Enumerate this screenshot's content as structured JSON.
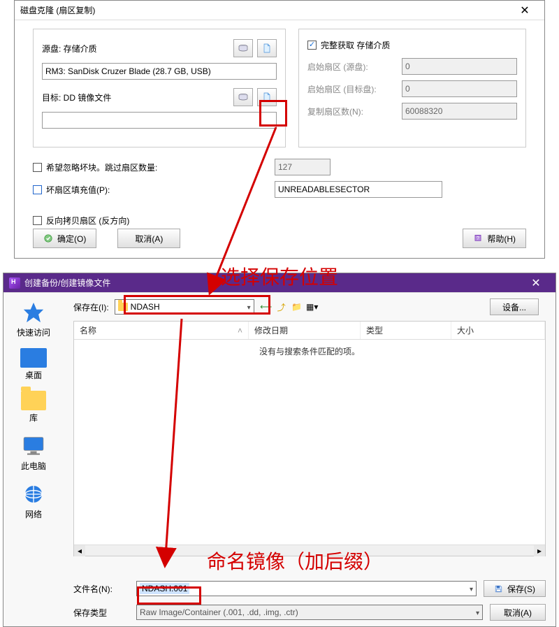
{
  "clone_dialog": {
    "title": "磁盘克隆 (扇区复制)",
    "source_label": "源盘: 存储介质",
    "source_value": "RM3: SanDisk Cruzer Blade (28.7 GB, USB)",
    "target_label": "目标: DD 镜像文件",
    "target_value": "",
    "full_extract_label": "完整获取 存储介质",
    "start_sector_src_label": "启始扇区 (源盘):",
    "start_sector_src_value": "0",
    "start_sector_dst_label": "启始扇区 (目标盘):",
    "start_sector_dst_value": "0",
    "copy_count_label": "复制扇区数(N):",
    "copy_count_value": "60088320",
    "ignore_bad_label": "希望忽略坏块。跳过扇区数量:",
    "ignore_skip_value": "127",
    "bad_fill_label": "坏扇区填充值(P):",
    "bad_fill_value": "UNREADABLESECTOR",
    "reverse_label": "反向拷贝扇区 (反方向)",
    "ok": "确定(O)",
    "cancel": "取消(A)",
    "help": "帮助(H)"
  },
  "save_dialog": {
    "title": "创建备份/创建镜像文件",
    "save_in_label": "保存在(I):",
    "save_in_value": "NDASH",
    "settings": "设备...",
    "places": {
      "quick": "快速访问",
      "desktop": "桌面",
      "lib": "库",
      "pc": "此电脑",
      "net": "网络"
    },
    "cols": {
      "name": "名称",
      "mdate": "修改日期",
      "type": "类型",
      "size": "大小"
    },
    "empty": "没有与搜索条件匹配的项。",
    "filename_label": "文件名(N):",
    "filename_value": "NDASH.001",
    "filetype_label": "保存类型",
    "filetype_value": "Raw Image/Container (.001, .dd, .img, .ctr)",
    "save": "保存(S)",
    "cancel2": "取消(A)"
  },
  "annotations": {
    "a1": "选择保存位置",
    "a2": "命名镜像（加后缀）"
  }
}
